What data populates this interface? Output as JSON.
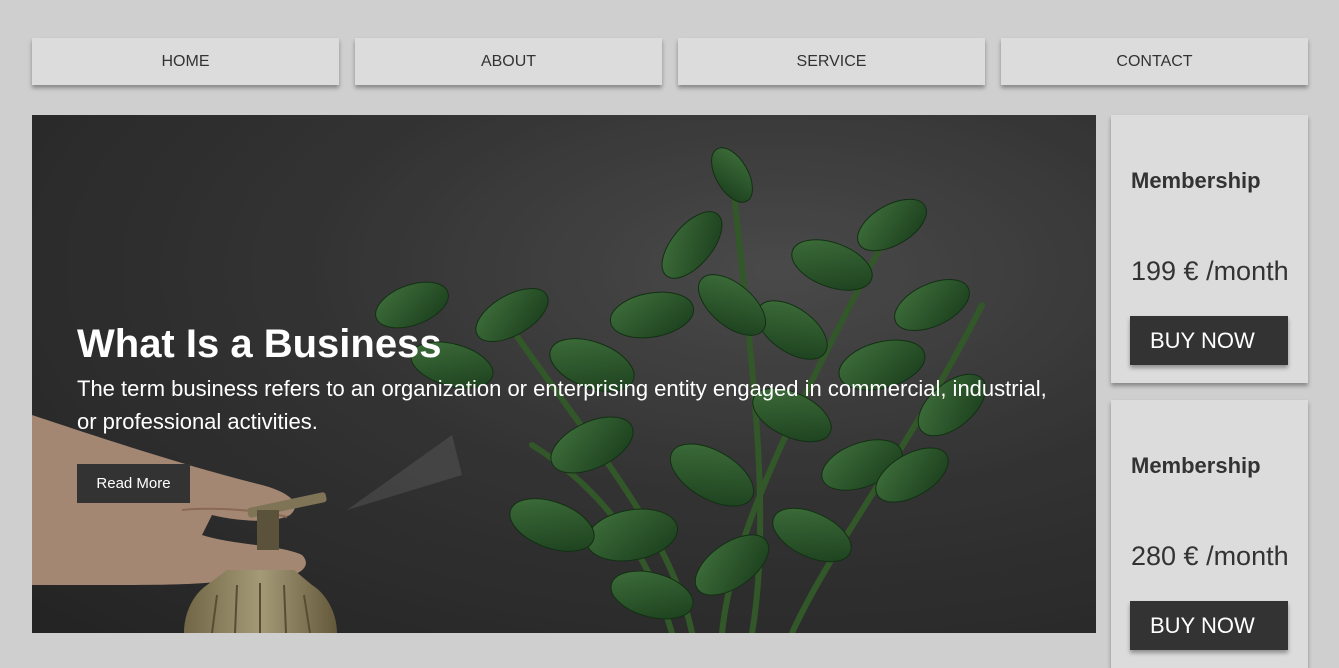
{
  "nav": {
    "items": [
      {
        "label": "HOME"
      },
      {
        "label": "ABOUT"
      },
      {
        "label": "SERVICE"
      },
      {
        "label": "CONTACT"
      }
    ]
  },
  "hero": {
    "title": "What Is a Business",
    "text": "The term business refers to an organization or enterprising entity engaged in commercial, industrial, or professional activities.",
    "button_label": "Read More",
    "image": "plant-being-sprayed-photo"
  },
  "pricing": [
    {
      "title": "Membership",
      "price": "199 € /month",
      "button_label": "BUY NOW"
    },
    {
      "title": "Membership",
      "price": "280 € /month",
      "button_label": "BUY NOW"
    }
  ],
  "colors": {
    "page_background": "#cfcfcf",
    "panel_background": "#dcdcdc",
    "dark_button": "#333333",
    "text_dark": "#333333",
    "text_light": "#ffffff"
  }
}
